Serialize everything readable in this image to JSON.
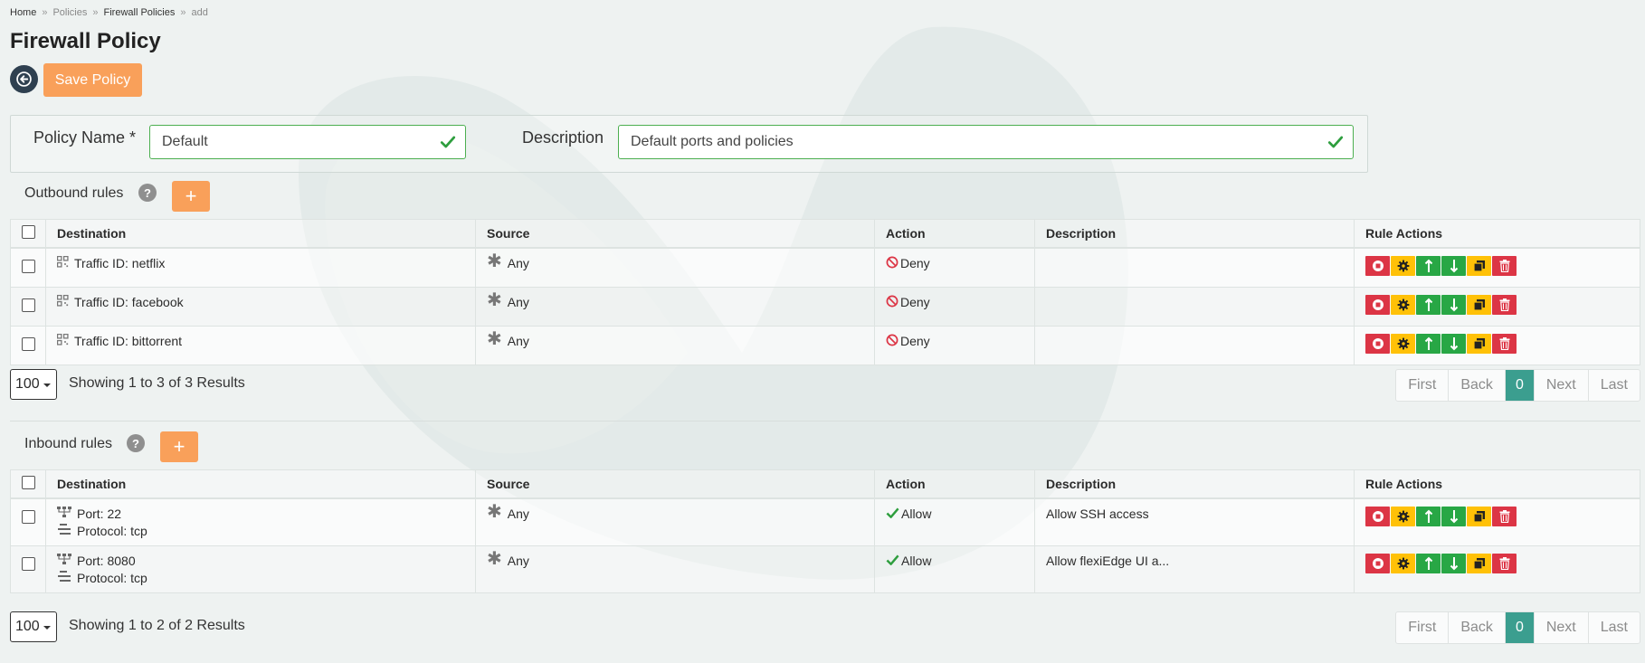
{
  "breadcrumb": [
    {
      "label": "Home"
    },
    {
      "label": "Policies"
    },
    {
      "label": "Firewall Policies"
    },
    {
      "label": "add"
    }
  ],
  "breadcrumb_separator": "»",
  "page_title": "Firewall Policy",
  "toolbar": {
    "save_label": "Save Policy",
    "back_icon": "arrow-left-circle-icon"
  },
  "policy_form": {
    "name_label": "Policy Name *",
    "name_value": "Default",
    "description_label": "Description",
    "description_value": "Default ports and policies"
  },
  "outbound": {
    "title": "Outbound rules",
    "help": "?",
    "add_label": "+",
    "columns": [
      "Destination",
      "Source",
      "Action",
      "Description",
      "Rule Actions"
    ],
    "rows": [
      {
        "destination": "Traffic ID: netflix",
        "source": "Any",
        "action": "Deny",
        "description": ""
      },
      {
        "destination": "Traffic ID: facebook",
        "source": "Any",
        "action": "Deny",
        "description": ""
      },
      {
        "destination": "Traffic ID: bittorrent",
        "source": "Any",
        "action": "Deny",
        "description": ""
      }
    ],
    "per_page": "100",
    "results": "Showing 1 to 3 of 3 Results",
    "pager": {
      "first": "First",
      "back": "Back",
      "current": "0",
      "next": "Next",
      "last": "Last"
    }
  },
  "inbound": {
    "title": "Inbound rules",
    "help": "?",
    "add_label": "+",
    "columns": [
      "Destination",
      "Source",
      "Action",
      "Description",
      "Rule Actions"
    ],
    "rows": [
      {
        "port": "Port: 22",
        "protocol": "Protocol: tcp",
        "source": "Any",
        "action": "Allow",
        "description": "Allow SSH access"
      },
      {
        "port": "Port: 8080",
        "protocol": "Protocol: tcp",
        "source": "Any",
        "action": "Allow",
        "description": "Allow flexiEdge UI a..."
      }
    ],
    "per_page": "100",
    "results": "Showing 1 to 2 of 2 Results",
    "pager": {
      "first": "First",
      "back": "Back",
      "current": "0",
      "next": "Next",
      "last": "Last"
    }
  },
  "rule_action_icons": [
    "stop-icon",
    "gear-icon",
    "move-up-icon",
    "move-down-icon",
    "copy-icon",
    "trash-icon"
  ],
  "colors": {
    "accent_orange": "#f9a05a",
    "valid_green": "#4caf50",
    "deny_red": "#dc3545",
    "allow_green": "#28a745",
    "action_yellow": "#ffc107",
    "pager_active": "#3b9e8f",
    "back_button": "#2f4050"
  }
}
